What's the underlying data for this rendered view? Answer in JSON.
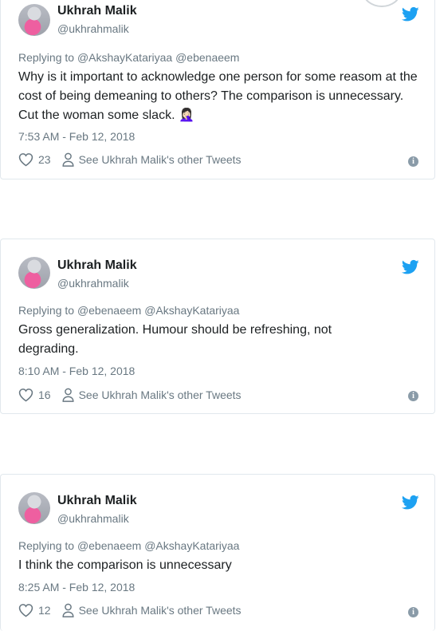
{
  "tweets": [
    {
      "author_name": "Ukhrah Malik",
      "author_handle": "@ukhrahmalik",
      "replying_prefix": "Replying to",
      "replying_to": "@AkshayKatariyaa @ebenaeem",
      "text": "Why is it important to acknowledge one person for some reasom at the cost of being demeaning to others? The comparison is unnecessary. Cut the woman some slack. 🤦🏻‍♀️",
      "timestamp": "7:53 AM - Feb 12, 2018",
      "likes": "23",
      "see_more_label": "See Ukhrah Malik's other Tweets",
      "info_label": "i"
    },
    {
      "author_name": "Ukhrah Malik",
      "author_handle": "@ukhrahmalik",
      "replying_prefix": "Replying to",
      "replying_to": "@ebenaeem @AkshayKatariyaa",
      "text": "Gross generalization. Humour should be refreshing, not degrading.",
      "timestamp": "8:10 AM - Feb 12, 2018",
      "likes": "16",
      "see_more_label": "See Ukhrah Malik's other Tweets",
      "info_label": "i"
    },
    {
      "author_name": "Ukhrah Malik",
      "author_handle": "@ukhrahmalik",
      "replying_prefix": "Replying to",
      "replying_to": "@ebenaeem @AkshayKatariyaa",
      "text": "I think the comparison is unnecessary",
      "timestamp": "8:25 AM - Feb 12, 2018",
      "likes": "12",
      "see_more_label": "See Ukhrah Malik's other Tweets",
      "info_label": "i"
    }
  ],
  "icons": {
    "brand": "twitter-bird-icon",
    "like": "heart-icon",
    "profile": "person-icon",
    "info": "info-icon"
  },
  "colors": {
    "twitter_blue": "#1da1f2",
    "secondary_text": "#697882",
    "border": "#e1e8ed"
  }
}
